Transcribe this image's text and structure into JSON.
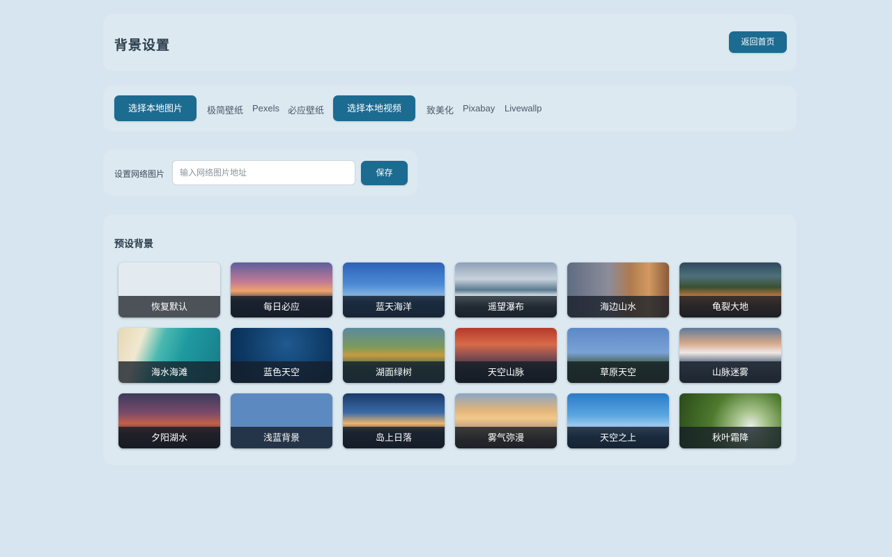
{
  "header": {
    "title": "背景设置",
    "back_label": "返回首页"
  },
  "sources": {
    "local_image": "选择本地图片",
    "minimal": "极简壁纸",
    "pexels": "Pexels",
    "bing": "必应壁纸",
    "local_video": "选择本地视频",
    "zhimeihua": "致美化",
    "pixabay": "Pixabay",
    "livewallp": "Livewallp"
  },
  "network": {
    "label": "设置网络图片",
    "placeholder": "输入网络图片地址",
    "value": "",
    "save_label": "保存"
  },
  "presets": {
    "title": "预设背景",
    "items": [
      {
        "label": "恢复默认"
      },
      {
        "label": "每日必应"
      },
      {
        "label": "蓝天海洋"
      },
      {
        "label": "遥望瀑布"
      },
      {
        "label": "海边山水"
      },
      {
        "label": "龟裂大地"
      },
      {
        "label": "海水海滩"
      },
      {
        "label": "蓝色天空"
      },
      {
        "label": "湖面绿树"
      },
      {
        "label": "天空山脉"
      },
      {
        "label": "草原天空"
      },
      {
        "label": "山脉迷雾"
      },
      {
        "label": "夕阳湖水"
      },
      {
        "label": "浅蓝背景"
      },
      {
        "label": "岛上日落"
      },
      {
        "label": "雾气弥漫"
      },
      {
        "label": "天空之上"
      },
      {
        "label": "秋叶霜降"
      }
    ]
  },
  "colors": {
    "page_bg": "#d6e5ef",
    "accent": "#1c6b91",
    "text": "#2e3e4c"
  }
}
